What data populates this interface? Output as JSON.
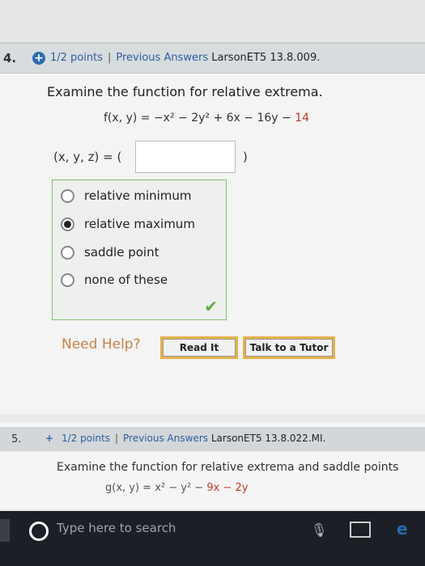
{
  "q4": {
    "number": "4.",
    "points": "1/2 points",
    "previous": "Previous Answers",
    "course": "LarsonET5 13.8.009.",
    "prompt": "Examine the function for relative extrema.",
    "func_main": "f(x, y) = −x² − 2y² + 6x − 16y − ",
    "func_red": "14",
    "answer_label": "(x, y, z) = (",
    "answer_value": "",
    "close_paren": ")",
    "options": [
      "relative minimum",
      "relative maximum",
      "saddle point",
      "none of these"
    ],
    "selected_option": "relative maximum",
    "help": "Need Help?",
    "read_it": "Read It",
    "tutor": "Talk to a Tutor"
  },
  "q5": {
    "number": "5.",
    "points": "1/2 points",
    "previous": "Previous Answers",
    "course": "LarsonET5 13.8.022.MI.",
    "prompt": "Examine the function for relative extrema and saddle points",
    "func_main": "g(x, y) = x² − y² − ",
    "func_red": "9x − 2y"
  },
  "taskbar": {
    "search_placeholder": "Type here to search"
  }
}
